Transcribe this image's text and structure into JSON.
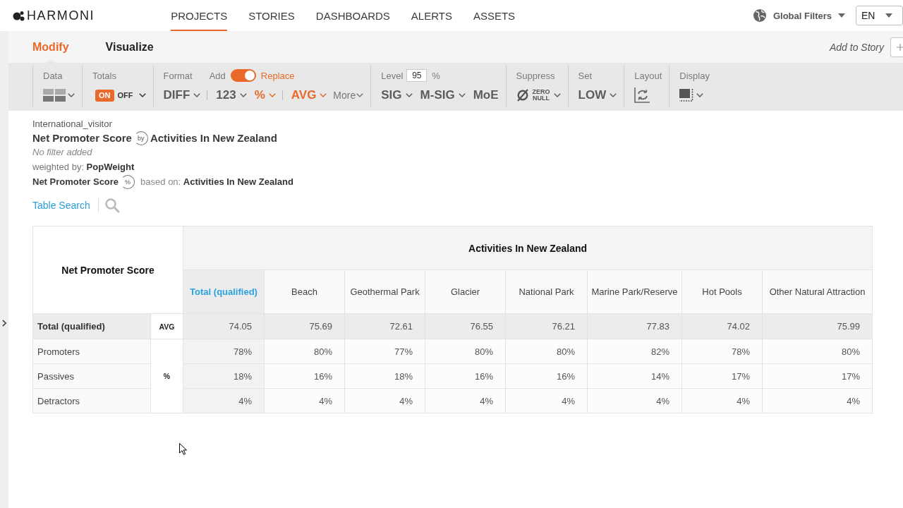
{
  "app": {
    "logo": "HARMONI"
  },
  "nav": [
    {
      "label": "PROJECTS",
      "selected": true
    },
    {
      "label": "STORIES",
      "selected": false
    },
    {
      "label": "DASHBOARDS",
      "selected": false
    },
    {
      "label": "ALERTS",
      "selected": false
    },
    {
      "label": "ASSETS",
      "selected": false
    }
  ],
  "global_filters": {
    "label": "Global Filters"
  },
  "language": {
    "value": "EN"
  },
  "mode_tabs": [
    {
      "label": "Modify",
      "selected": true
    },
    {
      "label": "Visualize",
      "selected": false
    }
  ],
  "add_to_story": {
    "label": "Add to Story"
  },
  "toolbar": {
    "data": {
      "label": "Data"
    },
    "totals": {
      "label": "Totals",
      "on_label": "ON",
      "off_label": "OFF",
      "on": true
    },
    "format": {
      "label": "Format",
      "switch": {
        "off_label": "Add",
        "on_label": "Replace",
        "on": true
      },
      "option_groups": [
        {
          "options": [
            {
              "label": "DIFF",
              "active": false
            }
          ]
        },
        {
          "options": [
            {
              "label": "123",
              "active": false
            },
            {
              "label": "%",
              "active": true
            }
          ]
        },
        {
          "options": [
            {
              "label": "AVG",
              "active": true
            }
          ]
        }
      ],
      "more": "More"
    },
    "level": {
      "label": "Level",
      "value": "95",
      "unit": "%",
      "options": [
        {
          "label": "SIG",
          "kind": "dropdown"
        },
        {
          "label": "M-SIG",
          "kind": "dropdown"
        },
        {
          "label": "MoE",
          "kind": "toggle"
        }
      ]
    },
    "suppress": {
      "label": "Suppress",
      "lines": [
        "ZERO",
        "NULL"
      ]
    },
    "set": {
      "label": "Set",
      "value": "LOW"
    },
    "layout": {
      "label": "Layout"
    },
    "display": {
      "label": "Display"
    }
  },
  "report": {
    "dataset": "International_visitor",
    "title": {
      "row_variable": "Net Promoter Score",
      "connector": "by",
      "column_variable": "Activities In New Zealand"
    },
    "filter_note": "No filter added",
    "weighting": "weighted by: **PopWeight**",
    "percent_base": {
      "variable": "Net Promoter Score",
      "mark": "%",
      "text": "based on: **Activities In New Zealand**"
    },
    "table_search": "Table Search"
  },
  "table": {
    "corner": "Net Promoter Score",
    "banner": "Activities In New Zealand",
    "columns": [
      {
        "label": "Total (qualified)",
        "kind": "total"
      },
      {
        "label": "Beach",
        "kind": "category"
      },
      {
        "label": "Geothermal Park",
        "kind": "category"
      },
      {
        "label": "Glacier",
        "kind": "category"
      },
      {
        "label": "National Park",
        "kind": "category"
      },
      {
        "label": "Marine Park/Reserve",
        "kind": "category"
      },
      {
        "label": "Hot Pools",
        "kind": "category"
      },
      {
        "label": "Other Natural Attraction",
        "kind": "category"
      }
    ],
    "row_groups": [
      {
        "stat": "AVG",
        "rows": [
          {
            "label": "Total (qualified)",
            "kind": "total",
            "values": [
              "74.05",
              "75.69",
              "72.61",
              "76.55",
              "76.21",
              "77.83",
              "74.02",
              "75.99"
            ]
          }
        ]
      },
      {
        "stat": "%",
        "rows": [
          {
            "label": "Promoters",
            "kind": "category",
            "values": [
              "78%",
              "80%",
              "77%",
              "80%",
              "80%",
              "82%",
              "78%",
              "80%"
            ]
          },
          {
            "label": "Passives",
            "kind": "category",
            "values": [
              "18%",
              "16%",
              "18%",
              "16%",
              "16%",
              "14%",
              "17%",
              "17%"
            ]
          },
          {
            "label": "Detractors",
            "kind": "category",
            "values": [
              "4%",
              "4%",
              "4%",
              "4%",
              "4%",
              "4%",
              "4%",
              "4%"
            ]
          }
        ]
      }
    ]
  }
}
